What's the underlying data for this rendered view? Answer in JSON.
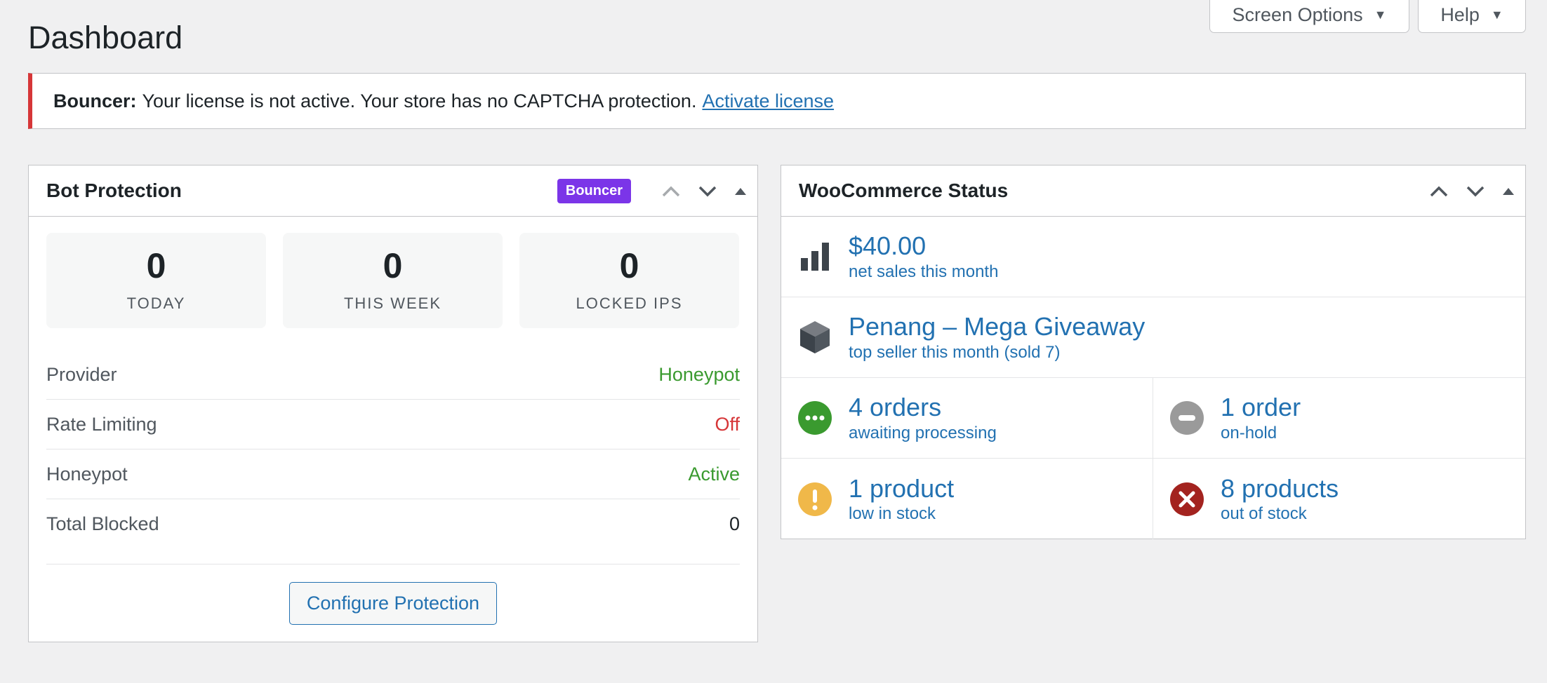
{
  "header": {
    "title": "Dashboard",
    "screen_options_label": "Screen Options",
    "help_label": "Help",
    "caret": "▼"
  },
  "notice": {
    "prefix": "Bouncer:",
    "message": "Your license is not active. Your store has no CAPTCHA protection.",
    "link": "Activate license",
    "accent_color": "#d63638"
  },
  "bot_panel": {
    "title": "Bot Protection",
    "badge": "Bouncer",
    "badge_color": "#7b35e8",
    "stats": [
      {
        "value": "0",
        "label": "TODAY"
      },
      {
        "value": "0",
        "label": "THIS WEEK"
      },
      {
        "value": "0",
        "label": "LOCKED IPS"
      }
    ],
    "rows": [
      {
        "key": "Provider",
        "value": "Honeypot",
        "color": "green"
      },
      {
        "key": "Rate Limiting",
        "value": "Off",
        "color": "red"
      },
      {
        "key": "Honeypot",
        "value": "Active",
        "color": "green"
      },
      {
        "key": "Total Blocked",
        "value": "0",
        "color": "dark"
      }
    ],
    "configure_label": "Configure Protection"
  },
  "woo_panel": {
    "title": "WooCommerce Status",
    "net_sales": {
      "value": "$40.00",
      "label": "net sales this month",
      "icon": "bar-chart-icon"
    },
    "top_seller": {
      "value": "Penang – Mega Giveaway",
      "label": "top seller this month (sold 7)",
      "icon": "box-icon"
    },
    "processing": {
      "value": "4 orders",
      "label": "awaiting processing",
      "icon": "processing-icon",
      "color": "#3a9a2f"
    },
    "on_hold": {
      "value": "1 order",
      "label": "on-hold",
      "icon": "on-hold-icon",
      "color": "#9a9a9a"
    },
    "low_stock": {
      "value": "1 product",
      "label": "low in stock",
      "icon": "warning-icon",
      "color": "#f0b849"
    },
    "out_of_stock": {
      "value": "8 products",
      "label": "out of stock",
      "icon": "error-icon",
      "color": "#a3231f"
    }
  },
  "colors": {
    "link": "#2271b1",
    "background": "#f0f0f1",
    "green": "#3a9a2f",
    "red": "#d63638"
  }
}
